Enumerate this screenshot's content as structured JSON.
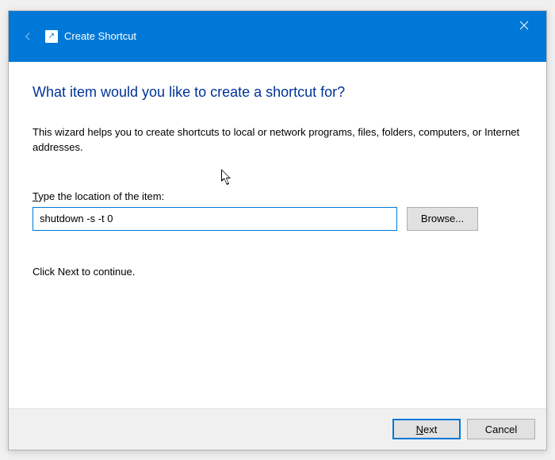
{
  "titlebar": {
    "title": "Create Shortcut"
  },
  "content": {
    "heading": "What item would you like to create a shortcut for?",
    "description": "This wizard helps you to create shortcuts to local or network programs, files, folders, computers, or Internet addresses.",
    "field_label_prefix": "T",
    "field_label_rest": "ype the location of the item:",
    "location_value": "shutdown -s -t 0",
    "browse_label": "Browse...",
    "continue_text": "Click Next to continue."
  },
  "footer": {
    "next_accel": "N",
    "next_rest": "ext",
    "cancel_label": "Cancel"
  }
}
